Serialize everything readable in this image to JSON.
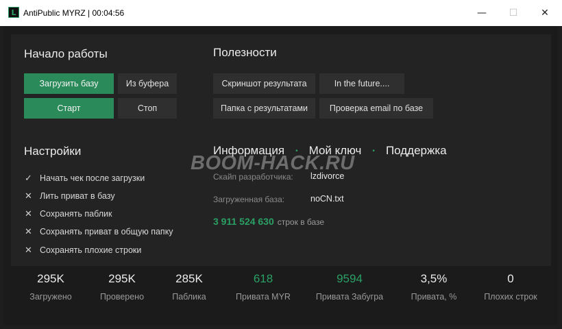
{
  "window": {
    "title": "AntiPublic MYRZ | 00:04:56",
    "icon_letter": "L",
    "min_glyph": "—",
    "max_glyph": "☐",
    "close_glyph": "✕"
  },
  "start": {
    "title": "Начало работы",
    "load_base": "Загрузить базу",
    "from_clipboard": "Из буфера",
    "start": "Старт",
    "stop": "Стоп"
  },
  "utilities": {
    "title": "Полезности",
    "screenshot": "Скриншот результата",
    "future": "In the future....",
    "results_folder": "Папка с результатами",
    "email_check": "Проверка email по базе"
  },
  "settings": {
    "title": "Настройки",
    "items": [
      {
        "mark": "✓",
        "label": "Начать чек после загрузки"
      },
      {
        "mark": "✕",
        "label": "Лить приват в базу"
      },
      {
        "mark": "✕",
        "label": "Сохранять паблик"
      },
      {
        "mark": "✕",
        "label": "Сохранять приват в общую папку"
      },
      {
        "mark": "✕",
        "label": "Сохранять плохие строки"
      }
    ]
  },
  "info": {
    "tabs": [
      "Информация",
      "Мой ключ",
      "Поддержка"
    ],
    "dot": "•",
    "dev_skype_label": "Скайп разработчика:",
    "dev_skype_value": "lzdivorce",
    "loaded_base_label": "Загруженная база:",
    "loaded_base_value": "noCN.txt",
    "rows_count": "3 911 524 630",
    "rows_suffix": "строк в базе"
  },
  "watermark": "BOOM-HACK.RU",
  "stats": [
    {
      "value": "295K",
      "label": "Загружено"
    },
    {
      "value": "295K",
      "label": "Проверено"
    },
    {
      "value": "285K",
      "label": "Паблика"
    },
    {
      "value": "618",
      "label": "Привата MYR"
    },
    {
      "value": "9594",
      "label": "Привата Забугра"
    },
    {
      "value": "3,5%",
      "label": "Привата, %"
    },
    {
      "value": "0",
      "label": "Плохих строк"
    }
  ],
  "colors": {
    "accent": "#2aa065",
    "button_green": "#2a8a5a",
    "button_dark": "#2f2f2f",
    "background": "#1b1b1b"
  }
}
